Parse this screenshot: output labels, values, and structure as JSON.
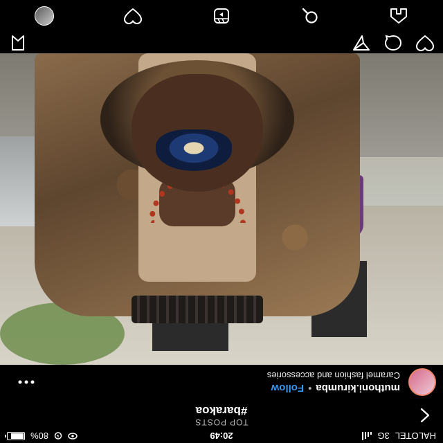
{
  "status_bar": {
    "carrier": "HALOTEL",
    "network": "3G",
    "time": "20:49",
    "battery": "80%",
    "battery_level": 0.8
  },
  "header": {
    "subtitle": "TOP POSTS",
    "title": "#barakoa",
    "back_icon": "chevron-left-icon"
  },
  "post": {
    "username": "muthoni.kirumba",
    "separator": "•",
    "follow_label": "Follow",
    "caption": "Caramel fashion and accessories",
    "more_icon": "more-horizontal-icon"
  },
  "actions": {
    "icons": [
      "heart-icon",
      "comment-icon",
      "share-icon",
      "bookmark-icon"
    ]
  },
  "bottom_nav": {
    "icons": [
      "home-icon",
      "search-icon",
      "reels-icon",
      "activity-heart-icon",
      "profile-avatar"
    ]
  },
  "colors": {
    "background": "#000000",
    "follow_blue": "#3797f0",
    "text": "#ffffff"
  }
}
